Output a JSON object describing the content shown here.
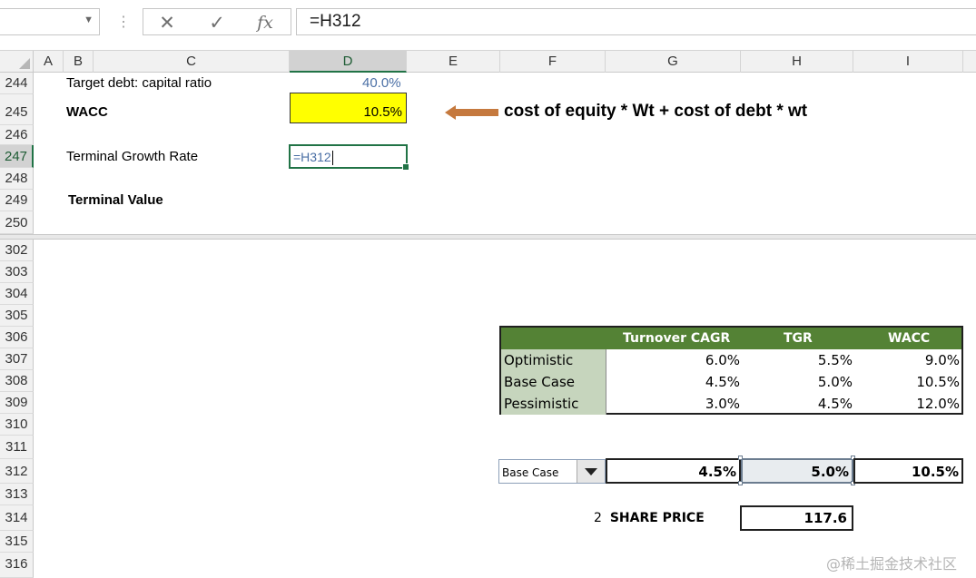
{
  "formula_bar": {
    "name_box": "",
    "cancel_icon": "✕",
    "enter_icon": "✓",
    "fx_label": "fx",
    "formula": "=H312"
  },
  "columns": [
    "A",
    "B",
    "C",
    "D",
    "E",
    "F",
    "G",
    "H",
    "I"
  ],
  "rows_top": [
    "244",
    "245",
    "246",
    "247",
    "248",
    "249",
    "250"
  ],
  "rows_bottom": [
    "302",
    "303",
    "304",
    "305",
    "306",
    "307",
    "308",
    "309",
    "310",
    "311",
    "312",
    "313",
    "314",
    "315",
    "316"
  ],
  "cells": {
    "target_debt_label": "Target debt: capital ratio",
    "target_debt_value": "40.0%",
    "wacc_label": "WACC",
    "wacc_value": "10.5%",
    "annotation": "cost of equity * Wt + cost of debt * wt",
    "tgr_label": "Terminal Growth Rate",
    "tgr_edit": "=H312",
    "terminal_value_label": "Terminal Value"
  },
  "scenario_table": {
    "headers": [
      "Turnover CAGR",
      "TGR",
      "WACC"
    ],
    "rows": [
      {
        "label": "Optimistic",
        "values": [
          "6.0%",
          "5.5%",
          "9.0%"
        ]
      },
      {
        "label": "Base Case",
        "values": [
          "4.5%",
          "5.0%",
          "10.5%"
        ]
      },
      {
        "label": "Pessimistic",
        "values": [
          "3.0%",
          "4.5%",
          "12.0%"
        ]
      }
    ]
  },
  "selected_scenario": {
    "dropdown": "Base Case",
    "values": [
      "4.5%",
      "5.0%",
      "10.5%"
    ]
  },
  "share_price": {
    "index": "2",
    "label": "SHARE PRICE",
    "value": "117.6"
  },
  "watermark": "@稀土掘金技术社区",
  "colors": {
    "header_green": "#548235",
    "label_green": "#c6d5bd",
    "highlight_yellow": "#ffff00",
    "arrow": "#c5793e",
    "selection": "#217346"
  }
}
